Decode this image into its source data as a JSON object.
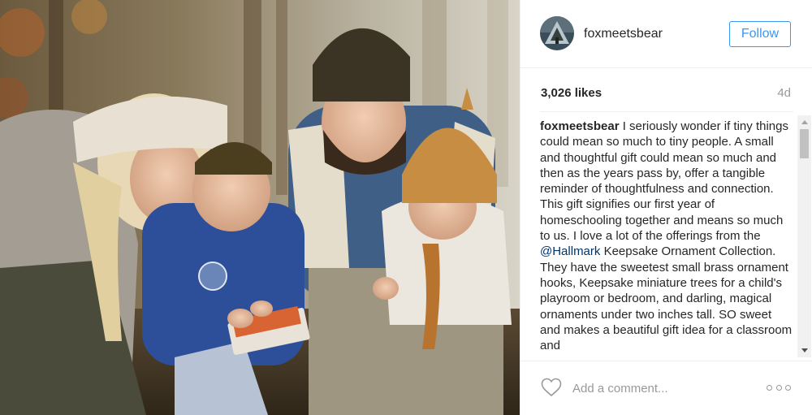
{
  "post": {
    "image_alt": "Family of four in autumn woods looking at a small gift box",
    "username": "foxmeetsbear",
    "follow_label": "Follow",
    "likes": "3,026 likes",
    "age": "4d",
    "caption": {
      "username": "foxmeetsbear",
      "text_before_mention": " I seriously wonder if tiny things could mean so much to tiny people. A small and thoughtful gift could mean so much and then as the years pass by, offer a tangible reminder of thoughtfulness and connection. This gift signifies our first year of homeschooling together and means so much to us. I love a lot of the offerings from the ",
      "mention": "@Hallmark",
      "text_after_mention": " Keepsake Ornament Collection. They have the sweetest small brass ornament hooks, Keepsake miniature trees for a child's playroom or bedroom, and darling, magical ornaments under two inches tall. SO sweet and makes a beautiful gift idea for a classroom and"
    },
    "comment_placeholder": "Add a comment...",
    "icons": {
      "like": "heart-icon",
      "more": "more-options-icon",
      "scroll_up": "chevron-up-icon",
      "scroll_down": "chevron-down-icon"
    },
    "colors": {
      "follow_blue": "#3897f0",
      "mention_blue": "#003569",
      "text": "#262626",
      "muted": "#999999"
    }
  }
}
